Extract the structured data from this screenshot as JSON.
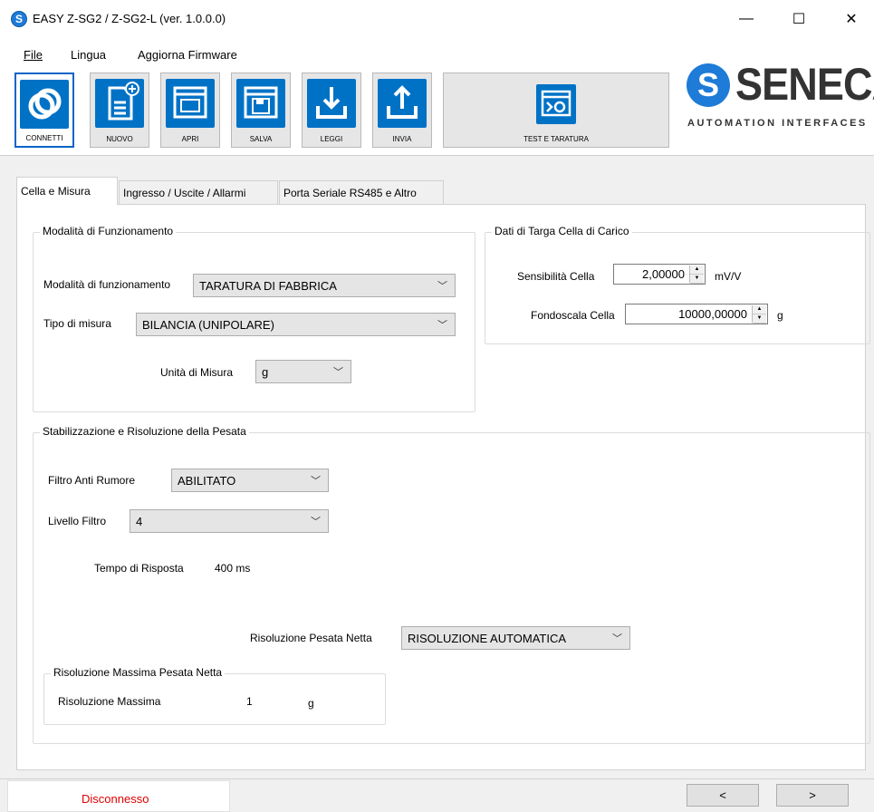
{
  "window": {
    "title": "EASY Z-SG2 / Z-SG2-L (ver. 1.0.0.0)",
    "minimize": "—",
    "maximize": "☐",
    "close": "✕"
  },
  "menu": {
    "file": "File",
    "lingua": "Lingua",
    "aggiorna": "Aggiorna Firmware"
  },
  "toolbar": {
    "connetti": "CONNETTI",
    "nuovo": "NUOVO",
    "apri": "APRI",
    "salva": "SALVA",
    "leggi": "LEGGI",
    "invia": "INVIA",
    "test": "TEST E TARATURA"
  },
  "logo": {
    "s": "S",
    "word": "SENECA",
    "sub": "AUTOMATION INTERFACES"
  },
  "tabs": [
    {
      "label": "Cella e Misura"
    },
    {
      "label": "Ingresso / Uscite / Allarmi"
    },
    {
      "label": "Porta Seriale RS485 e Altro"
    }
  ],
  "modalita": {
    "legend": "Modalità di Funzionamento",
    "mode_label": "Modalità di funzionamento",
    "mode_value": "TARATURA DI FABBRICA",
    "tipo_label": "Tipo di misura",
    "tipo_value": "BILANCIA (UNIPOLARE)",
    "unita_label": "Unità di Misura",
    "unita_value": "g"
  },
  "targa": {
    "legend": "Dati di Targa Cella di Carico",
    "sens_label": "Sensibilità Cella",
    "sens_value": "2,00000",
    "sens_unit": "mV/V",
    "fondo_label": "Fondoscala Cella",
    "fondo_value": "10000,00000",
    "fondo_unit": "g"
  },
  "stabilizzazione": {
    "legend": "Stabilizzazione e Risoluzione della Pesata",
    "filtro_label": "Filtro Anti Rumore",
    "filtro_value": "ABILITATO",
    "livello_label": "Livello Filtro",
    "livello_value": "4",
    "tempo_label": "Tempo di Risposta",
    "tempo_value": "400 ms",
    "risoluzione_label": "Risoluzione Pesata Netta",
    "risoluzione_value": "RISOLUZIONE AUTOMATICA"
  },
  "risoluzione_max": {
    "legend": "Risoluzione Massima Pesata Netta",
    "label": "Risoluzione Massima",
    "value": "1",
    "unit": "g"
  },
  "status": {
    "text": "Disconnesso",
    "prev": "<",
    "next": ">"
  }
}
